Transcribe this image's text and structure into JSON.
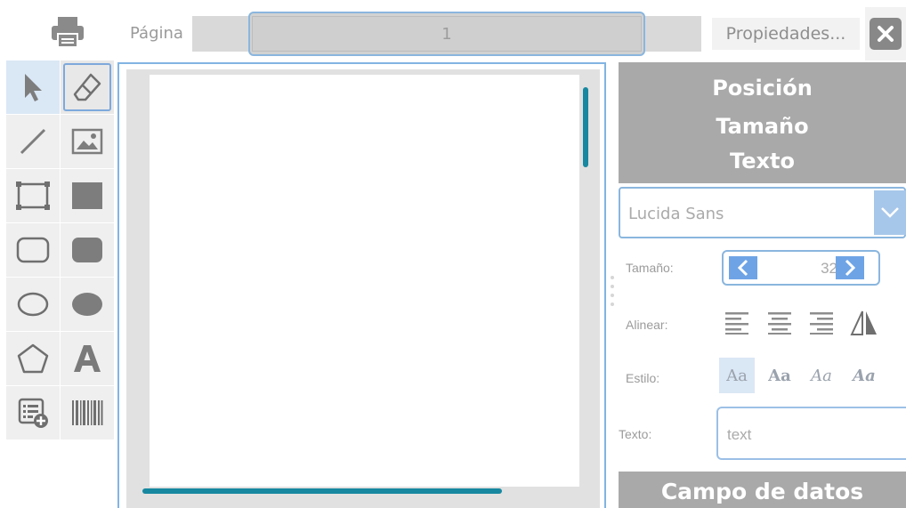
{
  "toolbar": {
    "page_label": "Página",
    "page_value": "1",
    "properties_label": "Propiedades...",
    "print_icon": "printer-icon",
    "close_icon": "close-icon"
  },
  "tools": [
    {
      "name": "select-tool",
      "icon": "arrow-pointer-icon"
    },
    {
      "name": "eraser-tool",
      "icon": "eraser-icon"
    },
    {
      "name": "line-tool",
      "icon": "line-icon"
    },
    {
      "name": "image-tool",
      "icon": "image-icon"
    },
    {
      "name": "rectangle-tool",
      "icon": "rectangle-outline-icon"
    },
    {
      "name": "filled-rectangle-tool",
      "icon": "rectangle-filled-icon"
    },
    {
      "name": "rounded-rectangle-tool",
      "icon": "rounded-rectangle-outline-icon"
    },
    {
      "name": "filled-rounded-rectangle-tool",
      "icon": "rounded-rectangle-filled-icon"
    },
    {
      "name": "ellipse-tool",
      "icon": "ellipse-outline-icon"
    },
    {
      "name": "filled-ellipse-tool",
      "icon": "ellipse-filled-icon"
    },
    {
      "name": "polygon-tool",
      "icon": "pentagon-icon"
    },
    {
      "name": "text-tool",
      "icon": "letter-a-icon"
    },
    {
      "name": "data-field-tool",
      "icon": "list-add-icon"
    },
    {
      "name": "barcode-tool",
      "icon": "barcode-icon"
    }
  ],
  "panel": {
    "position_header": "Posición",
    "size_header": "Tamaño",
    "text_header": "Texto",
    "font_name": "Lucida Sans",
    "size_label": "Tamaño:",
    "size_value": "32",
    "align_label": "Alinear:",
    "style_label": "Estilo:",
    "text_label": "Texto:",
    "text_value": "text",
    "data_field_header": "Campo de datos",
    "style_sample": "Aa"
  },
  "colors": {
    "accent": "#6ea4e6",
    "scrollbar": "#1788a0",
    "header_bg": "#a9a9a9",
    "border_focus": "#8ab6de"
  }
}
